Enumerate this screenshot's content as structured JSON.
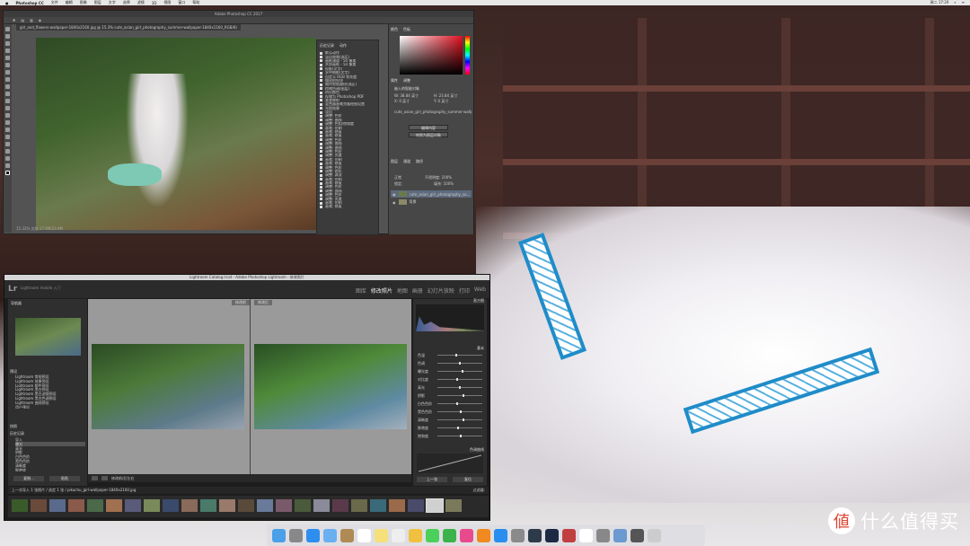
{
  "menubar": {
    "app": "Photoshop CC",
    "items": [
      "文件",
      "编辑",
      "图像",
      "图层",
      "文字",
      "选择",
      "滤镜",
      "3D",
      "视图",
      "窗口",
      "帮助"
    ],
    "clock": "周二 17:20"
  },
  "photoshop": {
    "title": "Adobe Photoshop CC 2017",
    "doc_tab": "girl_and_flowers-wallpaper-1840x2160.jpg @ 15.3% cute_asian_girl_photography_summer-wallpaper-1840x1160_RGB/8)",
    "zoom_status": "15.33%",
    "doc_status": "文档:17.0M/23.6M",
    "history_tabs": [
      "历史记录",
      "动作"
    ],
    "history_items": [
      "默认动作",
      "淡出效果(选区)",
      "画框通道 - 50 像素",
      "木质画框 - 50 像素",
      "投影(文字)",
      "水中倒影(文字)",
      "自定义 RGB 到灰度",
      "熔化的铅块",
      "制作剪贴路径(选区)",
      "棕褐色调(图层)",
      "四分颜色",
      "存储为 Photoshop PDF",
      "渐变映射",
      "混合器画笔克隆绘图设置",
      "光照效果",
      "淡出",
      "调整: 色阶",
      "调整: 曲线",
      "调整: 色相/饱和度",
      "画笔: 仿制",
      "画笔: 修复",
      "画笔: 修复",
      "调整: 色阶",
      "调整: 曲线",
      "调整: 曲线",
      "调整: 色阶",
      "调整: 亮度",
      "画笔: 仿制",
      "画笔: 修复",
      "调整: 色阶",
      "调整: 锐化",
      "调整: 减淡",
      "画笔: 仿制",
      "画笔: 修复",
      "调整: 色阶",
      "调整: 曲线",
      "调整: 色阶",
      "调整: 亮度",
      "画笔: 仿制",
      "画笔: 修复"
    ],
    "color_tabs": [
      "颜色",
      "色板"
    ],
    "props_tabs": [
      "属性",
      "调整"
    ],
    "props_label": "嵌入的智能对象",
    "w_label": "W: 38.84 英寸",
    "h_label": "H: 23.84 英寸",
    "x_label": "X: 0 英寸",
    "y_label": "Y: 0 英寸",
    "file_name": "cute_asian_girl_photography_summer-wallpaper...",
    "button_edit": "编辑内容",
    "button_convert": "转换为图层对象",
    "layers_tabs": [
      "图层",
      "通道",
      "路径"
    ],
    "blend_mode": "正常",
    "opacity": "不透明度: 100%",
    "lock_label": "锁定:",
    "fill": "填充: 100%",
    "layers": [
      "cute_asian_girl_photography_su...",
      "背景"
    ]
  },
  "lightroom": {
    "title": "Lightroom Catalog.lrcat - Adobe Photoshop Lightroom - 修改照片",
    "logo": "Lr",
    "subtitle": "Lightroom mobile 入门",
    "modules": [
      "图库",
      "修改照片",
      "地图",
      "画册",
      "幻灯片放映",
      "打印",
      "Web"
    ],
    "active_module": "修改照片",
    "left_panel": "导航器",
    "preset_header": "预设",
    "presets": [
      "Lightroom 常规预设",
      "Lightroom 效果预设",
      "Lightroom 颜色预设",
      "Lightroom 黑白预设",
      "Lightroom 黑白滤镜预设",
      "Lightroom 黑白色调预设",
      "Lightroom 曲线预设",
      "用户预设"
    ],
    "snapshot_header": "快照",
    "history_header": "历史记录",
    "history_items": [
      "导入",
      "曝光",
      "高光",
      "阴影",
      "白色色阶",
      "黑色色阶",
      "清晰度",
      "鲜艳度"
    ],
    "copy_btn": "复制...",
    "paste_btn": "粘贴",
    "before_label": "修改前",
    "after_label": "修改后",
    "histogram_label": "直方图",
    "basic_label": "基本",
    "sliders": [
      "色温",
      "色调",
      "曝光度",
      "对比度",
      "高光",
      "阴影",
      "白色色阶",
      "黑色色阶",
      "清晰度",
      "鲜艳度",
      "饱和度"
    ],
    "curve_label": "色调曲线",
    "prev_btn": "上一张",
    "reset_btn": "复位",
    "toolbar_text": "修改前/后左右",
    "film_text": "上一次导入 1 张照片 / 选定 1 张 / pikachu_girl-wallpaper-1840x2160.jpg",
    "filter_label": "过滤器:"
  },
  "watermark": "什么值得买"
}
